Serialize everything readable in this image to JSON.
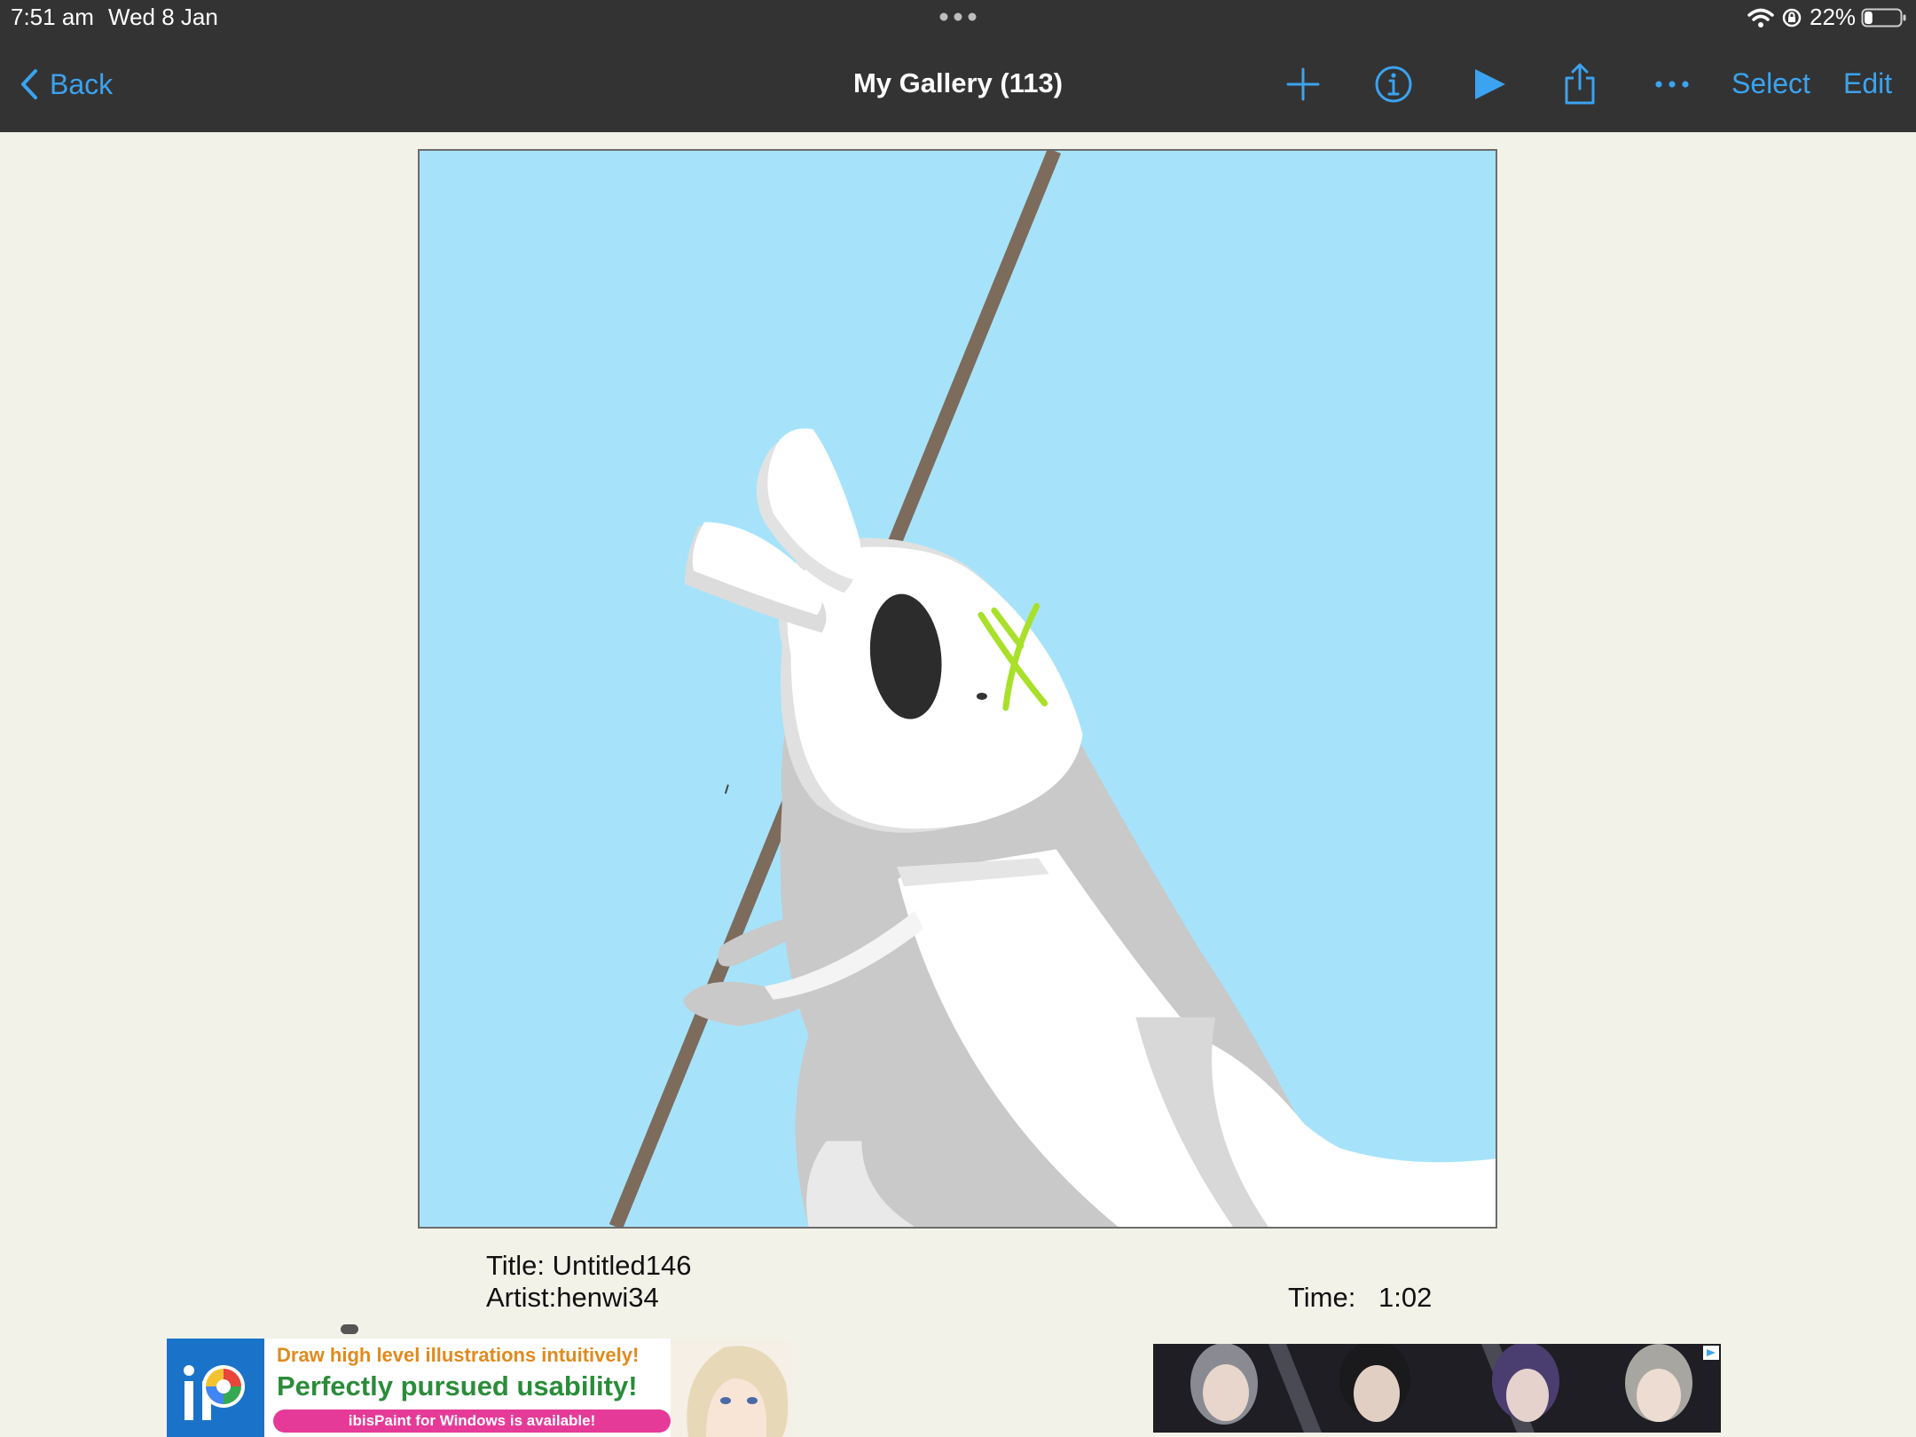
{
  "status_bar": {
    "time": "7:51 am",
    "date": "Wed 8 Jan",
    "battery_percent": "22%",
    "battery_level": 0.22
  },
  "nav": {
    "back_label": "Back",
    "title": "My Gallery (113)",
    "select_label": "Select",
    "edit_label": "Edit",
    "icons": [
      "plus-icon",
      "info-icon",
      "play-icon",
      "share-icon",
      "more-icon"
    ]
  },
  "artwork": {
    "background_color": "#a6e3fb"
  },
  "details": {
    "title_line": "Title: Untitled146",
    "artist_line": "Artist:henwi34",
    "time_label": "Time:",
    "time_value": "1:02"
  },
  "ads": {
    "left": {
      "line1": "Draw high level illustrations intuitively!",
      "line2": "Perfectly pursued usability!",
      "pill": "ibisPaint for Windows is available!"
    }
  },
  "colors": {
    "accent": "#3ba3ef",
    "navbar": "#333333",
    "page_background": "#f3f2e8"
  }
}
